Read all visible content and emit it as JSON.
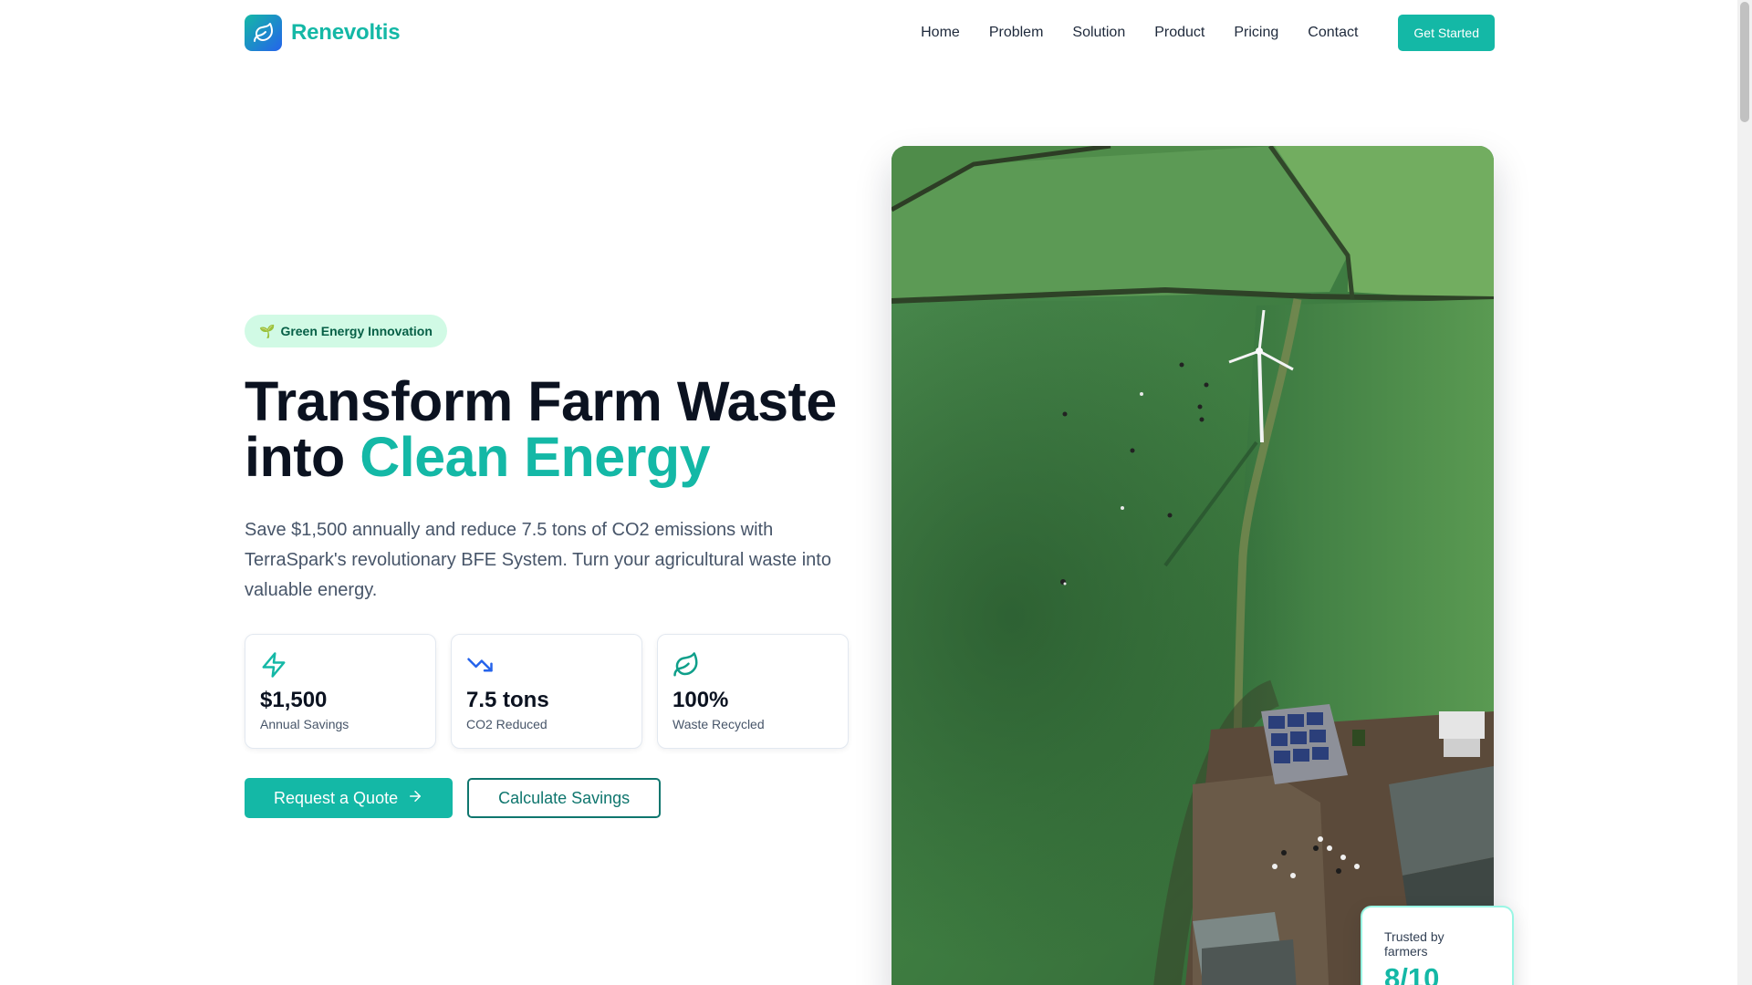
{
  "brand": {
    "name": "Renevoltis",
    "icon": "leaf-icon"
  },
  "nav": {
    "links": [
      "Home",
      "Problem",
      "Solution",
      "Product",
      "Pricing",
      "Contact"
    ],
    "cta": "Get Started"
  },
  "hero": {
    "badge": {
      "icon": "🌱",
      "label": "Green Energy Innovation"
    },
    "title_line1": "Transform Farm Waste",
    "title_line2_prefix": "into ",
    "title_line2_accent": "Clean Energy",
    "description": "Save $1,500 annually and reduce 7.5 tons of CO2 emissions with TerraSpark's revolutionary BFE System. Turn your agricultural waste into valuable energy.",
    "stats": [
      {
        "icon": "lightning-icon",
        "value": "$1,500",
        "label": "Annual Savings"
      },
      {
        "icon": "trending-down-icon",
        "value": "7.5 tons",
        "label": "CO2 Reduced"
      },
      {
        "icon": "leaf-icon",
        "value": "100%",
        "label": "Waste Recycled"
      }
    ],
    "primary_button": "Request a Quote",
    "secondary_button": "Calculate Savings",
    "image": "aerial-farm-wind-turbine-photo"
  },
  "trust": {
    "label": "Trusted by farmers",
    "value": "8/10"
  },
  "colors": {
    "accent": "#14b8a6",
    "dark_accent": "#0f766e",
    "badge_bg": "#d1fae5",
    "text": "#0b1220"
  }
}
